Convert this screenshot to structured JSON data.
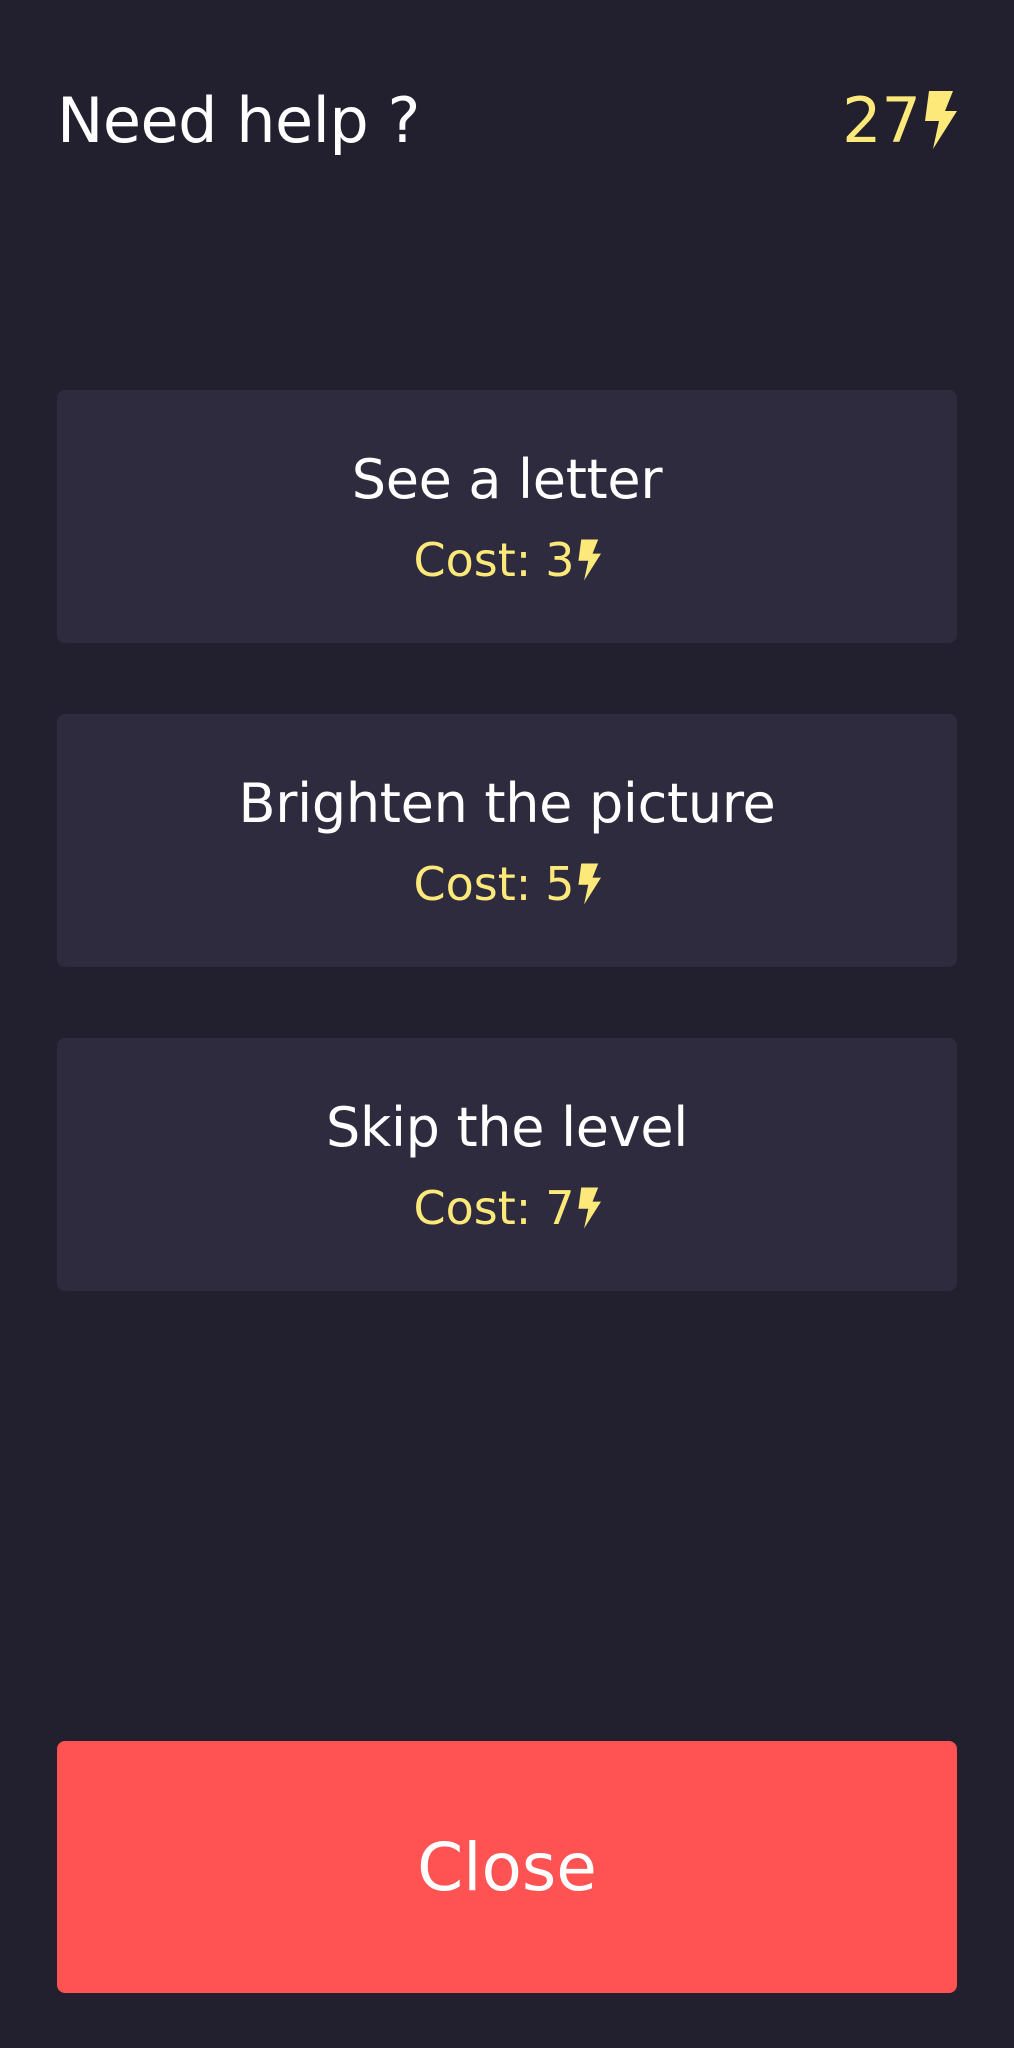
{
  "header": {
    "title": "Need help ?",
    "balance": "27",
    "currency_icon": "lightning-bolt-icon"
  },
  "options": [
    {
      "label": "See a letter",
      "cost_prefix": "Cost:",
      "cost": "3"
    },
    {
      "label": "Brighten the picture",
      "cost_prefix": "Cost:",
      "cost": "5"
    },
    {
      "label": "Skip the level",
      "cost_prefix": "Cost:",
      "cost": "7"
    }
  ],
  "close_button": {
    "label": "Close"
  },
  "colors": {
    "background": "#22202e",
    "card": "#2e2b3f",
    "accent_yellow": "#fde97a",
    "close_red": "#ff5252",
    "text": "#ffffff"
  }
}
